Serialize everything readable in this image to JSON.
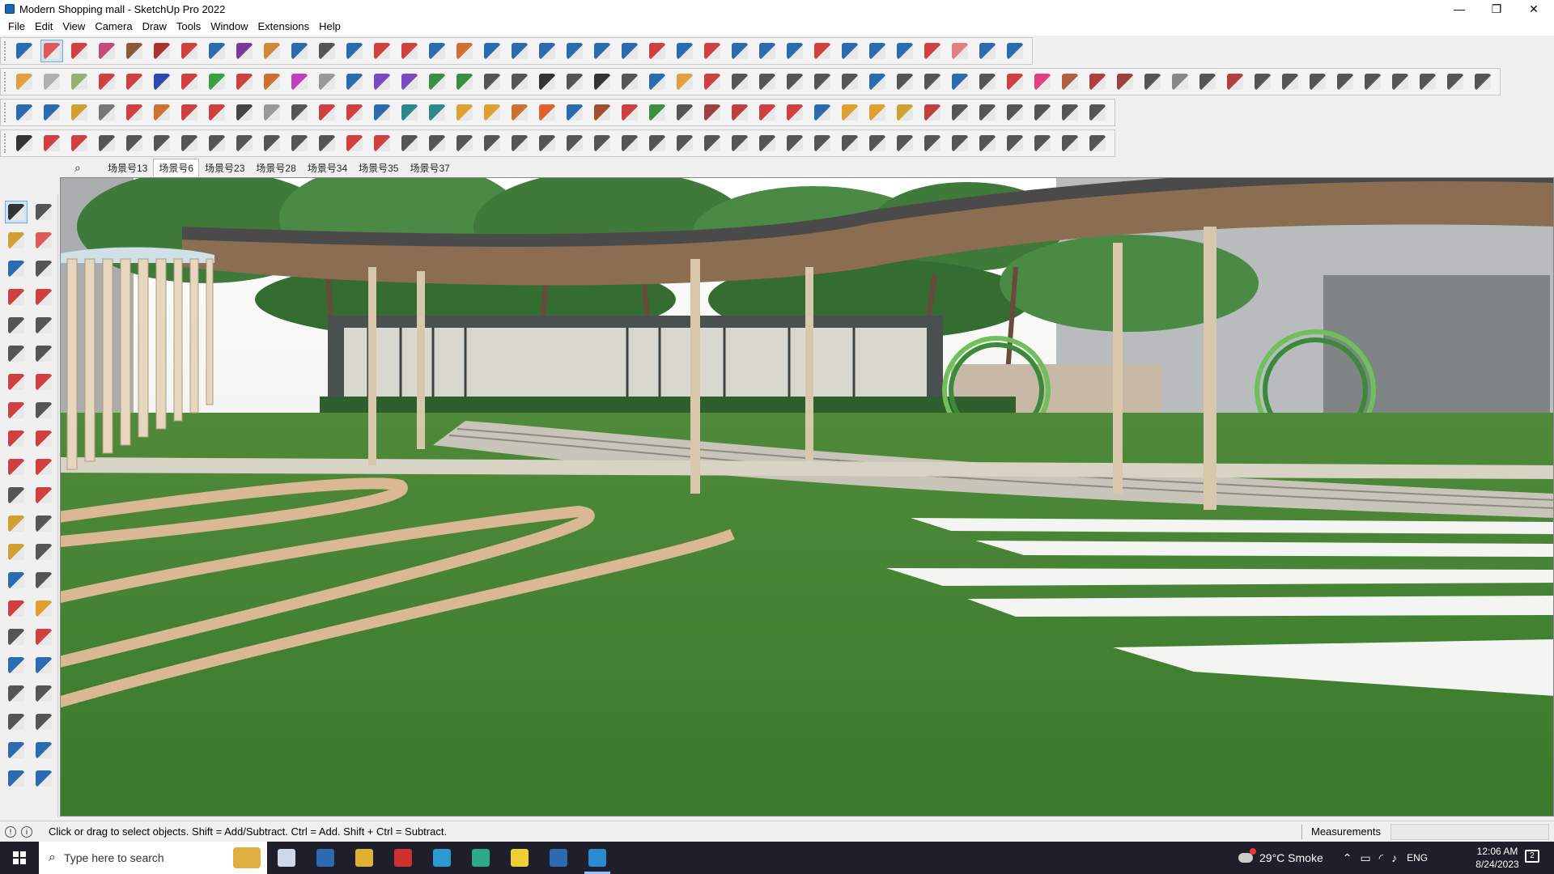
{
  "window": {
    "title": "Modern Shopping mall - SketchUp Pro 2022",
    "controls": {
      "minimize": "—",
      "maximize": "❐",
      "close": "✕"
    }
  },
  "menu": [
    "File",
    "Edit",
    "View",
    "Camera",
    "Draw",
    "Tools",
    "Window",
    "Extensions",
    "Help"
  ],
  "toolbar_rows": [
    {
      "count": 37,
      "colors": [
        "#2b6cb0",
        "#e05a5a",
        "#d04040",
        "#c24b7a",
        "#8a5a3a",
        "#b03030",
        "#d04040",
        "#2b6cb0",
        "#7a3a9a",
        "#d08a3a",
        "#2b6cb0",
        "#555",
        "#2b6cb0",
        "#d04040",
        "#d04040",
        "#2b6cb0",
        "#d07030",
        "#2b6cb0",
        "#2b6cb0",
        "#2b6cb0",
        "#2b6cb0",
        "#2b6cb0",
        "#2b6cb0",
        "#d04040",
        "#2b6cb0",
        "#d04040",
        "#2b6cb0",
        "#2b6cb0",
        "#2b6cb0",
        "#d04040",
        "#2b6cb0",
        "#2b6cb0",
        "#2b6cb0",
        "#d04040",
        "#e08080",
        "#2b6cb0",
        "#2b6cb0"
      ]
    },
    {
      "count": 54,
      "colors": [
        "#e0a040",
        "#b0b0b0",
        "#9ab070",
        "#d04040",
        "#d04040",
        "#2b4ab0",
        "#d04040",
        "#3aa040",
        "#d04040",
        "#d07030",
        "#c040c0",
        "#999",
        "#2b6cb0",
        "#7a4ac0",
        "#7a4ac0",
        "#3a9040",
        "#3a9040",
        "#555",
        "#555",
        "#333",
        "#555",
        "#333",
        "#555",
        "#2b6cb0",
        "#e0a040",
        "#d04040",
        "#555",
        "#555",
        "#555",
        "#555",
        "#555",
        "#2b6cb0",
        "#555",
        "#555",
        "#2b6cb0",
        "#555",
        "#d04040",
        "#e04080",
        "#b06040",
        "#b04040",
        "#a04040",
        "#555",
        "#888",
        "#555",
        "#b04040",
        "#555",
        "#555",
        "#555",
        "#555",
        "#555",
        "#555",
        "#555",
        "#555",
        "#555"
      ]
    },
    {
      "count": 40,
      "colors": [
        "#2b6cb0",
        "#2b6cb0",
        "#d0a030",
        "#777",
        "#d04040",
        "#d07030",
        "#d04040",
        "#d04040",
        "#444",
        "#999",
        "#555",
        "#d04040",
        "#d04040",
        "#2b6cb0",
        "#2b8a8a",
        "#2b8a8a",
        "#e0a030",
        "#e0a030",
        "#d07030",
        "#e06030",
        "#2b6cb0",
        "#a05030",
        "#d04040",
        "#3a9040",
        "#555",
        "#a04040",
        "#c04040",
        "#d04040",
        "#d04040",
        "#2b6cb0",
        "#e0a030",
        "#e0a030",
        "#d0a030",
        "#c04040",
        "#555",
        "#555",
        "#555",
        "#555",
        "#555",
        "#555"
      ]
    },
    {
      "count": 40,
      "colors": [
        "#333",
        "#d04040",
        "#d04040",
        "#555",
        "#555",
        "#555",
        "#555",
        "#555",
        "#555",
        "#555",
        "#555",
        "#555",
        "#d04040",
        "#d04040",
        "#555",
        "#555",
        "#555",
        "#555",
        "#555",
        "#555",
        "#555",
        "#555",
        "#555",
        "#555",
        "#555",
        "#555",
        "#555",
        "#555",
        "#555",
        "#555",
        "#555",
        "#555",
        "#555",
        "#555",
        "#555",
        "#555",
        "#555",
        "#555",
        "#555",
        "#555"
      ]
    }
  ],
  "scenes": {
    "tabs": [
      "场景号13",
      "场景号6",
      "场景号23",
      "场景号28",
      "场景号34",
      "场景号35",
      "场景号37"
    ],
    "active_index": 1
  },
  "left_toolbar_colors": [
    "#333",
    "#555",
    "#d0a030",
    "#e05a5a",
    "#2b6cb0",
    "#555",
    "#d04040",
    "#d04040",
    "#555",
    "#555",
    "#555",
    "#555",
    "#d04040",
    "#d04040",
    "#d04040",
    "#555",
    "#d04040",
    "#d04040",
    "#d04040",
    "#d04040",
    "#555",
    "#d04040",
    "#d0a030",
    "#555",
    "#d0a030",
    "#555",
    "#2b6cb0",
    "#555",
    "#d04040",
    "#e0a030",
    "#555",
    "#d04040",
    "#2b6cb0",
    "#2b6cb0",
    "#555",
    "#555",
    "#555",
    "#555",
    "#2b6cb0",
    "#2b6cb0",
    "#2b6cb0",
    "#2b6cb0"
  ],
  "status": {
    "message": "Click or drag to select objects. Shift = Add/Subtract. Ctrl = Add. Shift + Ctrl = Subtract.",
    "measurements_label": "Measurements",
    "measurements_value": ""
  },
  "taskbar": {
    "search_placeholder": "Type here to search",
    "apps": [
      {
        "name": "task-view",
        "color": "#cfd8e8"
      },
      {
        "name": "calculator",
        "color": "#2b6cb0"
      },
      {
        "name": "file-explorer",
        "color": "#e0b030"
      },
      {
        "name": "acrobat",
        "color": "#d03030"
      },
      {
        "name": "sketchup-3",
        "color": "#2b9ad0"
      },
      {
        "name": "edge",
        "color": "#2baa8a"
      },
      {
        "name": "sticky-notes",
        "color": "#f0d030"
      },
      {
        "name": "photos",
        "color": "#2b6cb0"
      },
      {
        "name": "sketchup",
        "color": "#2b8ad0"
      }
    ],
    "weather": "29°C  Smoke",
    "language": "ENG",
    "time": "12:06 AM",
    "date": "8/24/2023"
  }
}
